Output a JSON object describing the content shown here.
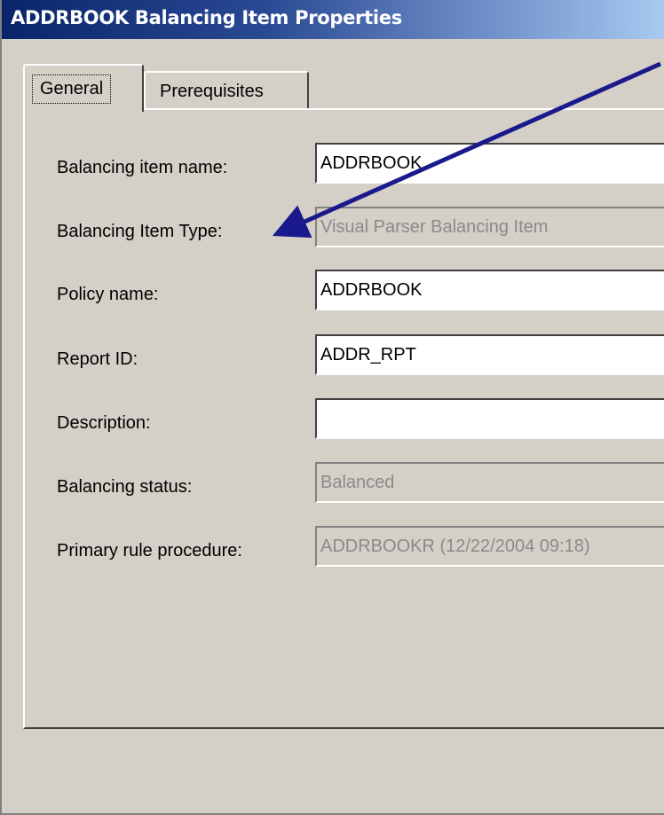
{
  "window": {
    "title": "ADDRBOOK Balancing Item Properties"
  },
  "tabs": [
    {
      "label": "General",
      "active": true
    },
    {
      "label": "Prerequisites",
      "active": false
    }
  ],
  "form": {
    "balancing_item_name": {
      "label": "Balancing item name:",
      "value": "ADDRBOOK",
      "enabled": true
    },
    "balancing_item_type": {
      "label": "Balancing Item Type:",
      "value": "Visual Parser Balancing Item",
      "enabled": false
    },
    "policy_name": {
      "label": "Policy name:",
      "value": "ADDRBOOK",
      "enabled": true
    },
    "report_id": {
      "label": "Report ID:",
      "value": "ADDR_RPT",
      "enabled": true
    },
    "description": {
      "label": "Description:",
      "value": "",
      "enabled": true
    },
    "balancing_status": {
      "label": "Balancing status:",
      "value": "Balanced",
      "enabled": false
    },
    "primary_rule_procedure": {
      "label": "Primary rule procedure:",
      "value": "ADDRBOOKR (12/22/2004 09:18)",
      "enabled": false
    }
  },
  "annotation": {
    "arrow_color": "#1a1a8c"
  },
  "colors": {
    "titlebar_start": "#0a246a",
    "titlebar_end": "#a6caf0",
    "dialog_face": "#d4d0c8"
  }
}
